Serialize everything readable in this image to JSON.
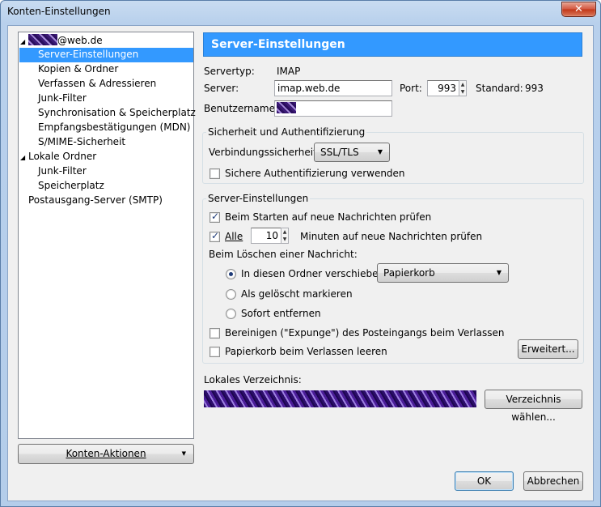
{
  "window": {
    "title": "Konten-Einstellungen",
    "close_glyph": "✕"
  },
  "tree": {
    "account_suffix": "@web.de",
    "items": [
      "Server-Einstellungen",
      "Kopien & Ordner",
      "Verfassen & Adressieren",
      "Junk-Filter",
      "Synchronisation & Speicherplatz",
      "Empfangsbestätigungen (MDN)",
      "S/MIME-Sicherheit"
    ],
    "local_folders": "Lokale Ordner",
    "local_items": [
      "Junk-Filter",
      "Speicherplatz"
    ],
    "smtp": "Postausgang-Server (SMTP)"
  },
  "account_actions": "Konten-Aktionen",
  "header": "Server-Einstellungen",
  "server": {
    "type_label": "Servertyp:",
    "type_value": "IMAP",
    "server_label": "Server:",
    "server_value": "imap.web.de",
    "port_label": "Port:",
    "port_value": "993",
    "standard_label": "Standard:",
    "standard_value": "993",
    "user_label": "Benutzername:"
  },
  "security": {
    "title": "Sicherheit und Authentifizierung",
    "conn_label": "Verbindungssicherheit:",
    "conn_value": "SSL/TLS",
    "secure_auth": "Sichere Authentifizierung verwenden"
  },
  "server_settings": {
    "title": "Server-Einstellungen",
    "check_start": "Beim Starten auf neue Nachrichten prüfen",
    "every_label": "Alle",
    "minutes_value": "10",
    "minutes_label": "Minuten auf neue Nachrichten prüfen",
    "delete_label": "Beim Löschen einer Nachricht:",
    "move_label": "In diesen Ordner verschieben:",
    "move_folder": "Papierkorb",
    "mark_deleted": "Als gelöscht markieren",
    "delete_now": "Sofort entfernen",
    "expunge": "Bereinigen (\"Expunge\") des Posteingangs beim Verlassen",
    "empty_trash": "Papierkorb beim Verlassen leeren",
    "advanced_btn": "Erweitert..."
  },
  "local_dir": {
    "label": "Lokales Verzeichnis:",
    "choose_btn": "Verzeichnis wählen..."
  },
  "buttons": {
    "ok": "OK",
    "cancel": "Abbrechen"
  }
}
